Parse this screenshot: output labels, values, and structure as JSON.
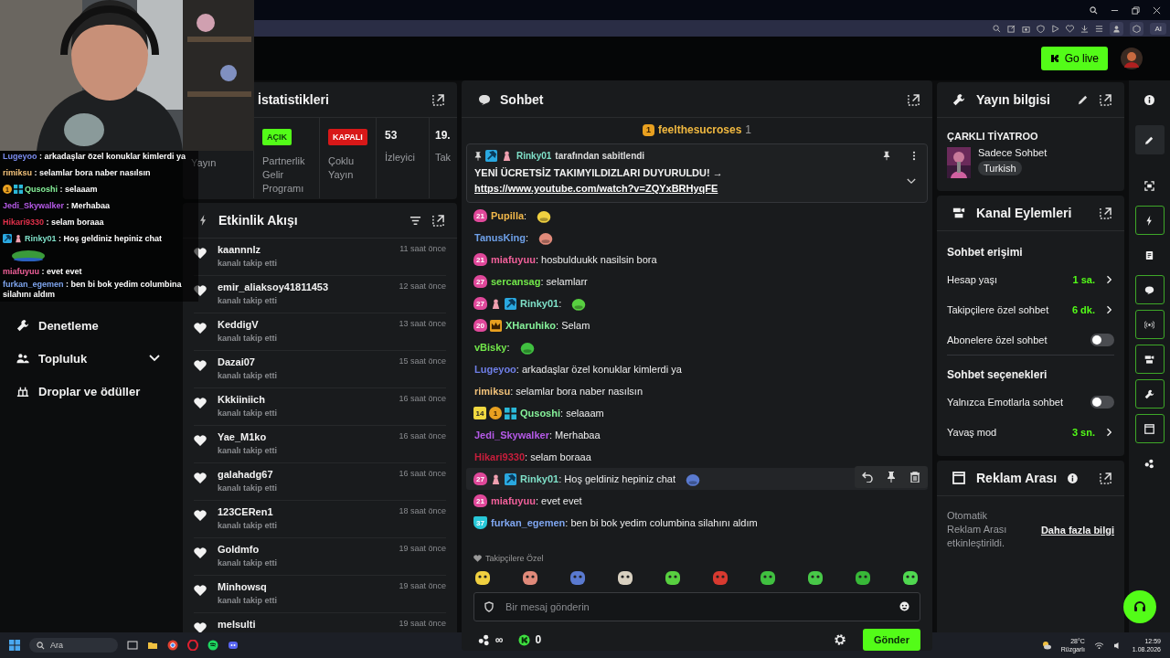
{
  "browser": {
    "ai_button": "AI"
  },
  "header": {
    "go_live": "Go live"
  },
  "nav": [
    {
      "label": "Denetleme",
      "kind": "link"
    },
    {
      "label": "Topluluk",
      "kind": "group"
    },
    {
      "label": "Droplar ve ödüller",
      "kind": "link"
    }
  ],
  "stream_overlay": {
    "lines": [
      {
        "user": "Lugeyoo",
        "color": "#7b8cf0",
        "text": ": arkadaşlar özel konuklar kimlerdi ya"
      },
      {
        "user": "rimiksu",
        "color": "#f2c27a",
        "text": ": selamlar bora naber nasılsın"
      },
      {
        "user": "Qusoshi",
        "color": "#86f29a",
        "text": ": selaaam",
        "badges": [
          {
            "kind": "gift",
            "label": "1"
          },
          {
            "kind": "grid"
          }
        ]
      },
      {
        "user": "Jedi_Skywalker",
        "color": "#b65ae8",
        "text": ": Merhabaa"
      },
      {
        "user": "Hikari9330",
        "color": "#e0304a",
        "text": ": selam boraaa"
      },
      {
        "user": "Rinky01",
        "color": "#7fe0c8",
        "text": ": Hoş geldiniz hepiniz chat",
        "badges": [
          {
            "kind": "mod"
          },
          {
            "kind": "figure"
          }
        ]
      },
      {
        "kind": "emote"
      },
      {
        "user": "miafuyuu",
        "color": "#f0609a",
        "text": ": evet evet"
      },
      {
        "user": "furkan_egemen",
        "color": "#7fa6f0",
        "text": ": ben bi bok yedim columbina silahını aldım"
      }
    ]
  },
  "stats": {
    "title": "İstatistikleri",
    "cells": [
      {
        "kind": "plain",
        "label": "Yayın"
      },
      {
        "kind": "status",
        "on": true,
        "badge": "AÇIK",
        "label": "Partnerlik Gelir Programı"
      },
      {
        "kind": "status",
        "on": false,
        "badge": "KAPALI",
        "label": "Çoklu Yayın"
      },
      {
        "kind": "number",
        "value": "53",
        "label": "İzleyici"
      },
      {
        "kind": "number",
        "value": "19.",
        "label": "Tak"
      }
    ]
  },
  "activity": {
    "title": "Etkinlik Akışı",
    "items": [
      {
        "name": "kaannnlz",
        "action": "kanalı takip etti",
        "time": "11 saat önce"
      },
      {
        "name": "emir_aliaksoy41811453",
        "action": "kanalı takip etti",
        "time": "12 saat önce"
      },
      {
        "name": "KeddigV",
        "action": "kanalı takip etti",
        "time": "13 saat önce"
      },
      {
        "name": "Dazai07",
        "action": "kanalı takip etti",
        "time": "15 saat önce"
      },
      {
        "name": "Kkkiiniich",
        "action": "kanalı takip etti",
        "time": "16 saat önce"
      },
      {
        "name": "Yae_M1ko",
        "action": "kanalı takip etti",
        "time": "16 saat önce"
      },
      {
        "name": "galahadg67",
        "action": "kanalı takip etti",
        "time": "16 saat önce"
      },
      {
        "name": "123CERen1",
        "action": "kanalı takip etti",
        "time": "18 saat önce"
      },
      {
        "name": "Goldmfo",
        "action": "kanalı takip etti",
        "time": "19 saat önce"
      },
      {
        "name": "Minhowsq",
        "action": "kanalı takip etti",
        "time": "19 saat önce"
      },
      {
        "name": "melsulti",
        "time": "19 saat önce"
      }
    ]
  },
  "chat": {
    "title": "Sohbet",
    "top_gifter": {
      "rank": "1",
      "name": "feelthesucroses",
      "count": "1"
    },
    "pinned": {
      "by": "Rinky01",
      "by_text": "tarafından sabitlendi",
      "message": "YENİ ÜCRETSİZ TAKIMYILDIZLARI DUYURULDU! →",
      "link": "https://www.youtube.com/watch?v=ZQYxBRHyqFE"
    },
    "messages": [
      {
        "user": "Pupilla",
        "color": "#f2b84a",
        "text": ":",
        "emote": true,
        "hovered": false,
        "badges": [
          {
            "kind": "sub",
            "label": "21",
            "color": "#e0489a"
          }
        ]
      },
      {
        "user": "TanusKing",
        "color": "#6ea0e8",
        "text": ":",
        "emote": true,
        "hovered": false
      },
      {
        "user": "miafuyuu",
        "color": "#f0609a",
        "text": ": hosbulduukk nasilsin bora",
        "emote": false,
        "hovered": false,
        "badges": [
          {
            "kind": "sub",
            "label": "21",
            "color": "#e0489a"
          }
        ]
      },
      {
        "user": "sercansag",
        "color": "#72e84a",
        "text": ": selamlarr",
        "emote": false,
        "hovered": false,
        "badges": [
          {
            "kind": "sub",
            "label": "27",
            "color": "#e0489a"
          }
        ]
      },
      {
        "user": "Rinky01",
        "color": "#7fe0c8",
        "text": ":",
        "emote": true,
        "hovered": false,
        "badges": [
          {
            "kind": "sub",
            "label": "27",
            "color": "#e0489a"
          },
          {
            "kind": "figure"
          },
          {
            "kind": "mod"
          }
        ]
      },
      {
        "user": "XHaruhiko",
        "color": "#86f29a",
        "text": ": Selam",
        "emote": false,
        "hovered": false,
        "badges": [
          {
            "kind": "sub",
            "label": "20",
            "color": "#e0489a"
          },
          {
            "kind": "crown"
          }
        ]
      },
      {
        "user": "vBisky",
        "color": "#72e84a",
        "text": ":",
        "emote": true,
        "hovered": false
      },
      {
        "user": "Lugeyoo",
        "color": "#6f7fe8",
        "text": ": arkadaşlar özel konuklar kimlerdi ya",
        "emote": false,
        "hovered": false
      },
      {
        "user": "rimiksu",
        "color": "#f2c27a",
        "text": ": selamlar bora naber nasılsın",
        "emote": false,
        "hovered": false
      },
      {
        "user": "Qusoshi",
        "color": "#86f29a",
        "text": ": selaaam",
        "emote": false,
        "hovered": false,
        "badges": [
          {
            "kind": "level",
            "label": "14",
            "color": "#f0d840"
          },
          {
            "kind": "gift",
            "label": "1"
          },
          {
            "kind": "grid"
          }
        ]
      },
      {
        "user": "Jedi_Skywalker",
        "color": "#b65ae8",
        "text": ": Merhabaa",
        "emote": false,
        "hovered": false
      },
      {
        "user": "Hikari9330",
        "color": "#c81e3c",
        "text": ": selam boraaa",
        "emote": false,
        "hovered": false
      },
      {
        "user": "Rinky01",
        "color": "#7fe0c8",
        "text": ": Hoş geldiniz hepiniz chat",
        "emote": true,
        "hovered": true,
        "badges": [
          {
            "kind": "sub",
            "label": "27",
            "color": "#e0489a"
          },
          {
            "kind": "figure"
          },
          {
            "kind": "mod"
          }
        ]
      },
      {
        "user": "miafuyuu",
        "color": "#f0609a",
        "text": ": evet evet",
        "emote": false,
        "hovered": false,
        "badges": [
          {
            "kind": "sub",
            "label": "21",
            "color": "#e0489a"
          }
        ]
      },
      {
        "user": "furkan_egemen",
        "color": "#7fa6f0",
        "text": ": ben bi bok yedim columbina silahını aldım",
        "emote": false,
        "hovered": false,
        "badges": [
          {
            "kind": "shield",
            "label": "37",
            "color": "#28c8d8"
          }
        ]
      }
    ],
    "emote_label": "Takipçilere Özel",
    "input": {
      "placeholder": "Bir mesaj gönderin"
    },
    "points": "∞",
    "coins": "0",
    "send": "Gönder"
  },
  "stream_info": {
    "title": "Yayın bilgisi",
    "stream_title": "ÇARKLI TİYATROO",
    "category": "Sadece Sohbet",
    "tag": "Turkish"
  },
  "channel_actions": {
    "title": "Kanal Eylemleri",
    "sections": [
      {
        "title": "Sohbet erişimi",
        "rows": [
          {
            "kind": "value",
            "label": "Hesap yaşı",
            "value": "1 sa."
          },
          {
            "kind": "value",
            "label": "Takipçilere özel sohbet",
            "value": "6 dk."
          },
          {
            "kind": "toggle",
            "label": "Abonelere özel sohbet",
            "on": false
          }
        ]
      },
      {
        "title": "Sohbet seçenekleri",
        "rows": [
          {
            "kind": "toggle",
            "label": "Yalnızca Emotlarla sohbet",
            "on": false
          },
          {
            "kind": "value",
            "label": "Yavaş mod",
            "value": "3 sn."
          }
        ]
      }
    ]
  },
  "ad_break": {
    "title": "Reklam Arası",
    "text": "Otomatik Reklam Arası etkinleştirildi.",
    "link": "Daha fazla bilgi"
  },
  "rail": [
    {
      "kind": "info",
      "active": false,
      "selected": false
    },
    {
      "kind": "edit",
      "active": false,
      "selected": true
    },
    {
      "kind": "capture",
      "active": false,
      "selected": false
    },
    {
      "kind": "bolt",
      "active": true,
      "selected": false
    },
    {
      "kind": "note",
      "active": false,
      "selected": false
    },
    {
      "kind": "chat",
      "active": true,
      "selected": false
    },
    {
      "kind": "signal",
      "active": true,
      "selected": false
    },
    {
      "kind": "camera",
      "active": true,
      "selected": false
    },
    {
      "kind": "wrench",
      "active": true,
      "selected": false
    },
    {
      "kind": "window",
      "active": true,
      "selected": false
    },
    {
      "kind": "dots",
      "active": false,
      "selected": false
    }
  ],
  "taskbar": {
    "search": "Ara",
    "temperature": "28°C",
    "weather": "Rüzgarlı",
    "time": "12:59",
    "date": "1.08.2026"
  }
}
